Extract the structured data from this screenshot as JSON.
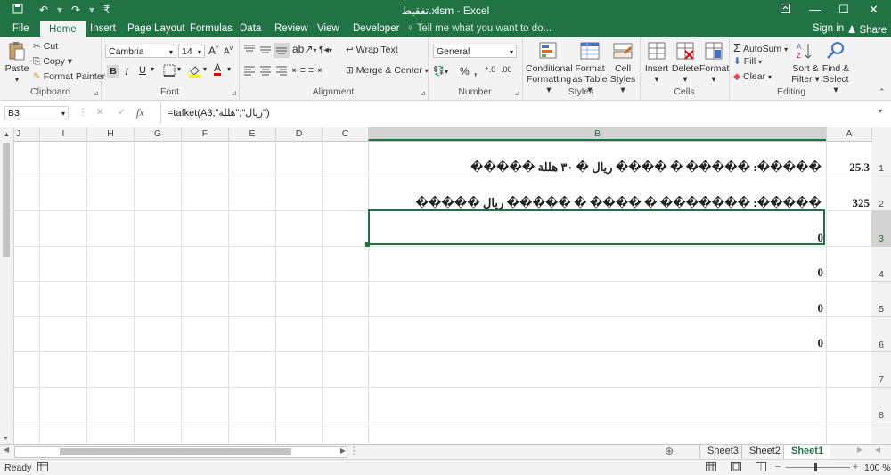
{
  "window": {
    "title": "تفقيط.xlsm - Excel",
    "quick_access": [
      "save-icon",
      "undo-icon",
      "redo-icon",
      "customize-icon"
    ],
    "controls": {
      "restore": "▫",
      "minimize": "—",
      "maximize": "☐",
      "close": "✕"
    }
  },
  "tabs": [
    {
      "label": "File"
    },
    {
      "label": "Home"
    },
    {
      "label": "Insert"
    },
    {
      "label": "Page Layout"
    },
    {
      "label": "Formulas"
    },
    {
      "label": "Data"
    },
    {
      "label": "Review"
    },
    {
      "label": "View"
    },
    {
      "label": "Developer"
    }
  ],
  "tell_me": "Tell me what you want to do...",
  "sign_in": "Sign in",
  "share": "Share",
  "ribbon": {
    "clipboard": {
      "paste": "Paste",
      "cut": "Cut",
      "copy": "Copy",
      "format_painter": "Format Painter",
      "label": "Clipboard"
    },
    "font": {
      "name": "Cambria",
      "size": "14",
      "bold": "B",
      "italic": "I",
      "underline": "U",
      "grow": "A",
      "shrink": "A",
      "font_color": "A",
      "label": "Font"
    },
    "alignment": {
      "wrap_text": "Wrap Text",
      "merge_center": "Merge & Center",
      "label": "Alignment"
    },
    "number": {
      "format": "General",
      "percent": "%",
      "comma": ",",
      "label": "Number"
    },
    "styles": {
      "conditional": "Conditional Formatting",
      "format_table": "Format as Table",
      "cell_styles": "Cell Styles",
      "label": "Styles"
    },
    "cells": {
      "insert": "Insert",
      "delete": "Delete",
      "format": "Format",
      "label": "Cells"
    },
    "editing": {
      "autosum": "AutoSum",
      "fill": "Fill",
      "clear": "Clear",
      "sort_filter": "Sort & Filter",
      "find_select": "Find & Select",
      "label": "Editing"
    }
  },
  "formula_bar": {
    "name_box": "B3",
    "fx": "fx",
    "formula": "=tafket(A3;\"ريال\";\"هللة\")"
  },
  "columns": [
    "J",
    "I",
    "H",
    "G",
    "F",
    "E",
    "D",
    "C",
    "B",
    "A"
  ],
  "rows": [
    "1",
    "2",
    "3",
    "4",
    "5",
    "6",
    "7",
    "8"
  ],
  "cells": {
    "A1": "25.3",
    "A2": "325",
    "B1": "�����: ����� � ���� ريال � ٣٠ هللة �����",
    "B2": "�����: ������� � ���� � ����� ريال �����",
    "B3": "0",
    "B4": "0",
    "B5": "0",
    "B6": "0"
  },
  "sheets": [
    "Sheet3",
    "Sheet2",
    "Sheet1"
  ],
  "active_sheet": "Sheet1",
  "status": {
    "ready": "Ready",
    "zoom": "100 %"
  },
  "colors": {
    "accent": "#217346",
    "ribbon_bg": "#f3f3f3"
  }
}
